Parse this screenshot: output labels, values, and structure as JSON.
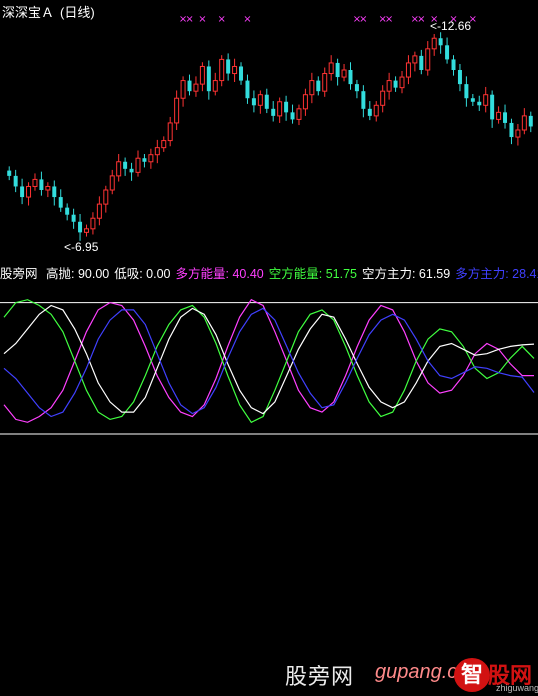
{
  "header": {
    "stock_name": "深深宝Ａ",
    "period": "(日线)"
  },
  "price_labels": {
    "high": "12.66",
    "low": "6.95"
  },
  "indicator_bar": {
    "name": "股旁网",
    "items": [
      {
        "label": "高抛:",
        "value": "90.00",
        "color": "#ffffff"
      },
      {
        "label": "低吸:",
        "value": "0.00",
        "color": "#ffffff"
      },
      {
        "label": "多方能量:",
        "value": "40.40",
        "color": "#ff40ff"
      },
      {
        "label": "空方能量:",
        "value": "51.75",
        "color": "#40ff40"
      },
      {
        "label": "空方主力:",
        "value": "61.59",
        "color": "#ffffff"
      },
      {
        "label": "多方主力:",
        "value": "28.41",
        "color": "#4040ff"
      }
    ]
  },
  "watermark": {
    "text": "股旁网",
    "url_text": "gupang.com",
    "logo_badge": "智",
    "logo_name": "股网",
    "logo_url": "zhiguwang"
  },
  "colors": {
    "up": "#ff3333",
    "down": "#33dddd",
    "marker": "#ff40ff",
    "bull_energy": "#ff40ff",
    "bear_energy": "#40ff40",
    "bear_main": "#ffffff",
    "bull_main": "#4040ff"
  },
  "chart_data": [
    {
      "type": "candlestick",
      "title": "深深宝Ａ (日线)",
      "ylim": [
        6.5,
        13.3
      ],
      "annotations": [
        {
          "label": "12.66",
          "kind": "high"
        },
        {
          "label": "6.95",
          "kind": "low"
        }
      ],
      "closes": [
        8.6,
        8.3,
        8.0,
        8.3,
        8.5,
        8.2,
        8.3,
        8.0,
        7.7,
        7.5,
        7.3,
        7.0,
        7.1,
        7.4,
        7.8,
        8.2,
        8.6,
        9.0,
        8.8,
        8.7,
        9.1,
        9.0,
        9.2,
        9.4,
        9.6,
        10.1,
        10.8,
        11.3,
        11.0,
        11.2,
        11.7,
        11.0,
        11.3,
        11.9,
        11.5,
        11.7,
        11.3,
        10.8,
        10.6,
        10.9,
        10.5,
        10.3,
        10.7,
        10.4,
        10.2,
        10.5,
        10.9,
        11.3,
        11.0,
        11.5,
        11.8,
        11.4,
        11.6,
        11.2,
        11.0,
        10.5,
        10.3,
        10.6,
        11.0,
        11.3,
        11.1,
        11.4,
        11.8,
        12.0,
        11.6,
        12.2,
        12.5,
        12.3,
        11.9,
        11.6,
        11.2,
        10.8,
        10.7,
        10.6,
        10.9,
        10.2,
        10.4,
        10.1,
        9.7,
        9.9,
        10.3,
        10.0
      ],
      "top_markers": [
        27,
        28,
        30,
        33,
        37,
        54,
        55,
        58,
        59,
        63,
        64,
        66,
        69,
        72
      ]
    },
    {
      "type": "line",
      "title": "股旁网",
      "ylim": [
        0,
        100
      ],
      "reference_lines": [
        90,
        0
      ],
      "series": [
        {
          "name": "多方能量",
          "values": [
            20,
            10,
            8,
            12,
            18,
            30,
            50,
            70,
            85,
            90,
            88,
            78,
            60,
            40,
            25,
            15,
            12,
            20,
            38,
            60,
            80,
            92,
            88,
            70,
            50,
            30,
            18,
            15,
            22,
            40,
            60,
            78,
            88,
            85,
            70,
            50,
            35,
            28,
            30,
            40,
            55,
            62,
            58,
            48,
            40,
            40
          ]
        },
        {
          "name": "空方能量",
          "values": [
            80,
            90,
            92,
            88,
            82,
            70,
            50,
            30,
            15,
            10,
            12,
            22,
            40,
            60,
            75,
            85,
            88,
            80,
            62,
            40,
            20,
            8,
            12,
            30,
            50,
            70,
            82,
            85,
            78,
            60,
            40,
            22,
            12,
            15,
            30,
            50,
            65,
            72,
            70,
            60,
            45,
            38,
            42,
            52,
            60,
            51.75
          ]
        },
        {
          "name": "空方主力",
          "values": [
            55,
            62,
            72,
            82,
            88,
            85,
            72,
            55,
            35,
            22,
            15,
            15,
            25,
            45,
            65,
            80,
            86,
            82,
            68,
            48,
            30,
            18,
            14,
            22,
            40,
            58,
            72,
            82,
            80,
            65,
            48,
            32,
            22,
            18,
            22,
            35,
            50,
            60,
            62,
            58,
            54,
            55,
            58,
            60,
            61,
            61.59
          ]
        },
        {
          "name": "多方主力",
          "values": [
            45,
            38,
            28,
            18,
            12,
            15,
            28,
            45,
            65,
            78,
            85,
            85,
            75,
            55,
            35,
            20,
            14,
            18,
            32,
            52,
            70,
            82,
            86,
            78,
            60,
            42,
            28,
            18,
            20,
            35,
            52,
            68,
            78,
            82,
            78,
            65,
            50,
            40,
            38,
            42,
            46,
            45,
            42,
            40,
            39,
            28.41
          ]
        }
      ]
    }
  ]
}
